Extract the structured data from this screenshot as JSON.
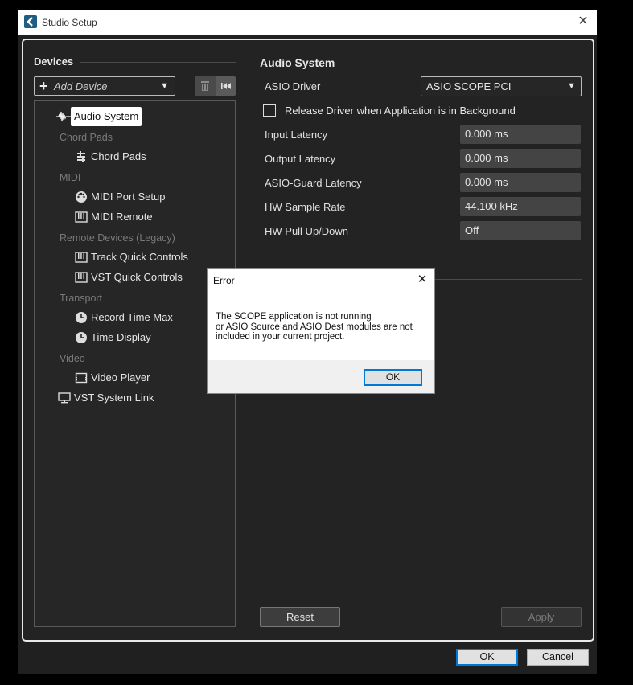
{
  "window": {
    "title": "Studio Setup",
    "close_glyph": "✕"
  },
  "left": {
    "title": "Devices",
    "add_device_label": "Add Device",
    "tree": {
      "audio_system": "Audio System",
      "cat_chord_pads": "Chord Pads",
      "chord_pads": "Chord Pads",
      "cat_midi": "MIDI",
      "midi_port_setup": "MIDI Port Setup",
      "midi_remote": "MIDI Remote",
      "cat_remote": "Remote Devices (Legacy)",
      "track_quick_controls": "Track Quick Controls",
      "vst_quick_controls": "VST Quick Controls",
      "cat_transport": "Transport",
      "record_time_max": "Record Time Max",
      "time_display": "Time Display",
      "cat_video": "Video",
      "video_player": "Video Player",
      "vst_system_link": "VST System Link"
    }
  },
  "right": {
    "title": "Audio System",
    "asio_driver_label": "ASIO Driver",
    "asio_driver_value": "ASIO SCOPE PCI",
    "release_driver_label": "Release Driver when Application is in Background",
    "release_driver_checked": false,
    "input_latency_label": "Input Latency",
    "input_latency_value": "0.000 ms",
    "output_latency_label": "Output Latency",
    "output_latency_value": "0.000 ms",
    "asio_guard_label": "ASIO-Guard Latency",
    "asio_guard_value": "0.000 ms",
    "hw_sample_rate_label": "HW Sample Rate",
    "hw_sample_rate_value": "44.100 kHz",
    "hw_pull_label": "HW Pull Up/Down",
    "hw_pull_value": "Off",
    "reset_label": "Reset",
    "apply_label": "Apply"
  },
  "footer": {
    "ok_label": "OK",
    "cancel_label": "Cancel"
  },
  "dialog": {
    "title": "Error",
    "message_lines": [
      "The SCOPE application is not running",
      "or ASIO Source and ASIO Dest modules are not",
      "included in your current project."
    ],
    "ok_label": "OK"
  },
  "colors": {
    "accent": "#0078d7",
    "app_icon": "#1e5d84",
    "panel_bg": "#232323"
  }
}
